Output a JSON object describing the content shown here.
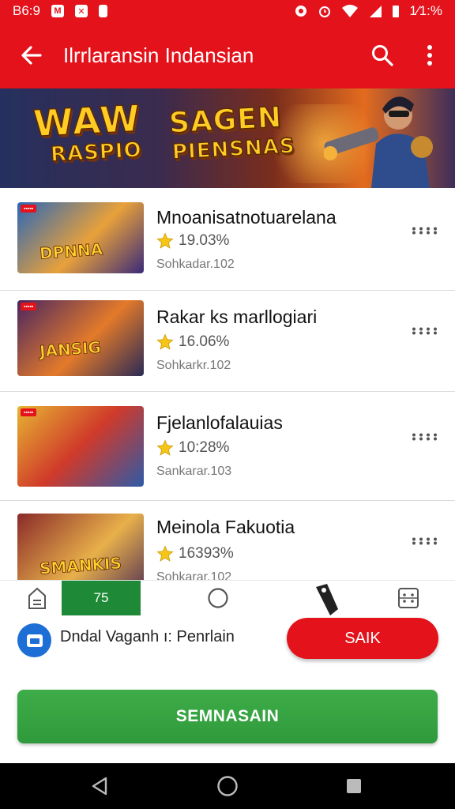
{
  "status_bar": {
    "time": "B6:9",
    "battery": "1⁄1:%"
  },
  "app_bar": {
    "title": "Ilrrlaransin Indansian"
  },
  "banner": {
    "line1": "WAW",
    "line2": "RASPIO",
    "line3": "SAGEN",
    "line4": "PIENSNAS"
  },
  "games": [
    {
      "title": "Mnoanisatnotuarelana",
      "rating": "19.03%",
      "subtitle": "Sohkadar.102",
      "thumb_word": "DPNNA",
      "colors": [
        "#2b66b8",
        "#e8a13a",
        "#3a2a7a"
      ]
    },
    {
      "title": "Rakar ks marllogiari",
      "rating": "16.06%",
      "subtitle": "Sohkarkr.102",
      "thumb_word": "JANSIG",
      "colors": [
        "#4a2660",
        "#e37a2a",
        "#2a2a55"
      ]
    },
    {
      "title": "Fjelanlofalauias",
      "rating": "10:28%",
      "subtitle": "Sankarar.103",
      "thumb_word": "",
      "colors": [
        "#e6b432",
        "#d03a2a",
        "#2e5aa8"
      ]
    },
    {
      "title": "Meinola Fakuotia",
      "rating": "16393%",
      "subtitle": "Sohkarar.102",
      "thumb_word": "SMANKIS",
      "colors": [
        "#8a2a2a",
        "#e8b04a",
        "#4a2a55"
      ]
    }
  ],
  "tabs": {
    "active_label": "75"
  },
  "promo": {
    "text": "Dndal Vaganh ı: Penrlain",
    "button_label": "SAIK"
  },
  "main_button": {
    "label": "SEMNASAIN"
  },
  "colors": {
    "accent": "#e3121b",
    "green": "#2f9a3b",
    "blue": "#1d6fd6"
  }
}
